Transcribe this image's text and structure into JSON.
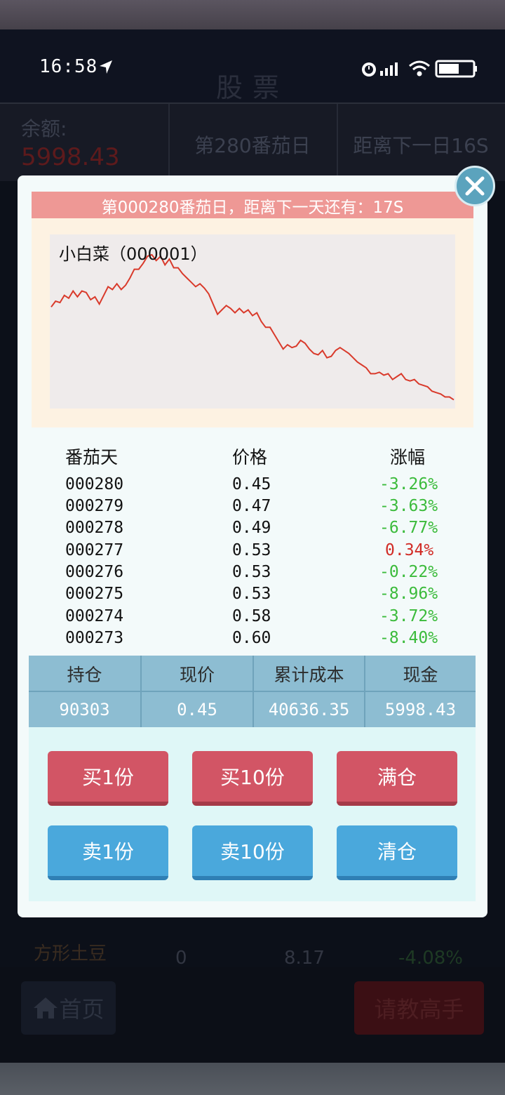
{
  "status_bar": {
    "time": "16:58"
  },
  "header": {
    "title": "股票"
  },
  "info_bar": {
    "balance_label": "余额:",
    "balance_value": "5998.43",
    "day": "第280番茄日",
    "next": "距离下一日16S"
  },
  "background_row": {
    "name": "方形土豆",
    "holding": "0",
    "price": "8.17",
    "change": "-4.08%"
  },
  "bottom_nav": {
    "home_label": "首页",
    "expert_label": "请教高手"
  },
  "modal": {
    "countdown": "第000280番茄日，距离下一天还有：17S",
    "stock_title": "小白菜（000001）",
    "table_headers": [
      "番茄天",
      "价格",
      "涨幅"
    ],
    "rows": [
      {
        "day": "000280",
        "price": "0.45",
        "change": "-3.26%",
        "dir": "down"
      },
      {
        "day": "000279",
        "price": "0.47",
        "change": "-3.63%",
        "dir": "down"
      },
      {
        "day": "000278",
        "price": "0.49",
        "change": "-6.77%",
        "dir": "down"
      },
      {
        "day": "000277",
        "price": "0.53",
        "change": "0.34%",
        "dir": "up"
      },
      {
        "day": "000276",
        "price": "0.53",
        "change": "-0.22%",
        "dir": "down"
      },
      {
        "day": "000275",
        "price": "0.53",
        "change": "-8.96%",
        "dir": "down"
      },
      {
        "day": "000274",
        "price": "0.58",
        "change": "-3.72%",
        "dir": "down"
      },
      {
        "day": "000273",
        "price": "0.60",
        "change": "-8.40%",
        "dir": "down"
      }
    ],
    "holdings": {
      "headers": [
        "持仓",
        "现价",
        "累计成本",
        "现金"
      ],
      "values": [
        "90303",
        "0.45",
        "40636.35",
        "5998.43"
      ]
    },
    "buttons": {
      "buy1": "买1份",
      "buy10": "买10份",
      "full": "满仓",
      "sell1": "卖1份",
      "sell10": "卖10份",
      "clear": "清仓"
    }
  },
  "chart_data": {
    "type": "line",
    "title": "小白菜（000001）",
    "line_color": "#d93a2b",
    "values": [
      1.3,
      1.34,
      1.33,
      1.38,
      1.36,
      1.41,
      1.37,
      1.41,
      1.4,
      1.35,
      1.37,
      1.32,
      1.38,
      1.44,
      1.42,
      1.46,
      1.42,
      1.45,
      1.5,
      1.56,
      1.56,
      1.6,
      1.65,
      1.66,
      1.62,
      1.65,
      1.59,
      1.63,
      1.57,
      1.57,
      1.53,
      1.5,
      1.47,
      1.44,
      1.46,
      1.43,
      1.39,
      1.32,
      1.25,
      1.28,
      1.31,
      1.29,
      1.26,
      1.29,
      1.26,
      1.28,
      1.24,
      1.26,
      1.2,
      1.16,
      1.16,
      1.11,
      1.06,
      1.01,
      1.04,
      1.02,
      1.03,
      1.07,
      1.05,
      1.01,
      0.98,
      0.97,
      1.0,
      0.95,
      0.96,
      1.0,
      1.02,
      1.0,
      0.98,
      0.95,
      0.92,
      0.9,
      0.88,
      0.84,
      0.84,
      0.85,
      0.83,
      0.84,
      0.8,
      0.82,
      0.84,
      0.8,
      0.79,
      0.8,
      0.77,
      0.76,
      0.75,
      0.72,
      0.71,
      0.7,
      0.68,
      0.68,
      0.66
    ],
    "ylim": [
      0.6,
      1.8
    ]
  }
}
